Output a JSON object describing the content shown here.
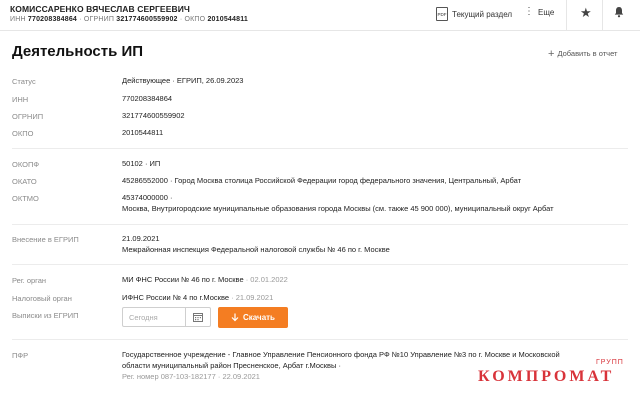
{
  "header": {
    "owner_name": "КОМИССАРЕНКО ВЯЧЕСЛАВ СЕРГЕЕВИЧ",
    "inn_label": "ИНН",
    "inn": "770208384864",
    "ogrnip_label": "· ОГРНИП",
    "ogrnip": "321774600559902",
    "okpo_label": "· ОКПО",
    "okpo": "2010544811",
    "section_label": "Текущий раздел",
    "more_label": "Еще"
  },
  "page": {
    "title": "Деятельность ИП",
    "add_to_report": "Добавить в отчет"
  },
  "details": {
    "status": {
      "label": "Статус",
      "value": "Действующее · ЕГРИП, 26.09.2023"
    },
    "inn": {
      "label": "ИНН",
      "value": "770208384864"
    },
    "ogrnip": {
      "label": "ОГРНИП",
      "value": "321774600559902"
    },
    "okpo": {
      "label": "ОКПО",
      "value": "2010544811"
    },
    "okopf": {
      "label": "ОКОПФ",
      "value": "50102 · ИП"
    },
    "okato": {
      "label": "ОКАТО",
      "value": "45286552000 · Город Москва столица Российской Федерации город федерального значения, Центральный, Арбат"
    },
    "oktmo": {
      "label": "ОКТМО",
      "code": "45374000000 ·",
      "value": "Москва, Внутригородские муниципальные образования города Москвы (см. также 45 900 000), муниципальный округ Арбат"
    },
    "egrip": {
      "label": "Внесение в ЕГРИП",
      "date": "21.09.2021",
      "value": "Межрайонная инспекция Федеральной налоговой службы № 46 по г. Москве"
    },
    "reg_organ": {
      "label": "Рег. орган",
      "value": "МИ ФНС России № 46 по г. Москве",
      "date": "· 02.01.2022"
    },
    "tax_organ": {
      "label": "Налоговый орган",
      "value": "ИФНС России № 4 по г.Москве",
      "date": "· 21.09.2021"
    },
    "extract": {
      "label": "Выписки из ЕГРИП",
      "placeholder": "Сегодня",
      "button": "Скачать"
    },
    "pfr": {
      "label": "ПФР",
      "line1": "Государственное учреждение - Главное Управление Пенсионного фонда РФ №10 Управление №3 по г. Москве и Московской",
      "line2": "области муниципальный район Пресненское, Арбат г.Москвы ·",
      "line3": "Рег. номер 087-103-182177 · 22.09.2021"
    }
  },
  "watermark": {
    "main": "КОМПРОМАТ",
    "sub": "ГРУПП"
  },
  "colors": {
    "accent": "#f47d22",
    "watermark": "#d8333a"
  }
}
